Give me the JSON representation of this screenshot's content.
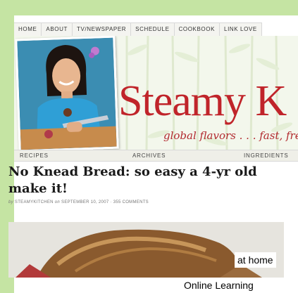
{
  "colors": {
    "frame": "#c5e4a3",
    "brand_red": "#c0242a",
    "text_dark": "#1a1a1a"
  },
  "top_nav": [
    "HOME",
    "ABOUT",
    "TV/NEWSPAPER",
    "SCHEDULE",
    "COOKBOOK",
    "LINK LOVE"
  ],
  "header": {
    "brand": "Steamy K",
    "tagline": "global flavors . . . fast, fresh"
  },
  "sub_nav": [
    "RECIPES",
    "ARCHIVES",
    "INGREDIENTS"
  ],
  "post": {
    "title": "No Knead Bread: so easy a 4-yr old can make it!",
    "title_line1": "No Knead Bread: so easy a 4-yr old",
    "title_line2": "make it!",
    "by_word": "by",
    "author": "STEAMYKITCHEN",
    "on_word": "on",
    "date": "SEPTEMBER 10, 2007",
    "separator": " · ",
    "comments": "355 COMMENTS"
  },
  "overlays": {
    "line1": "at home",
    "line2": "Online Learning"
  }
}
